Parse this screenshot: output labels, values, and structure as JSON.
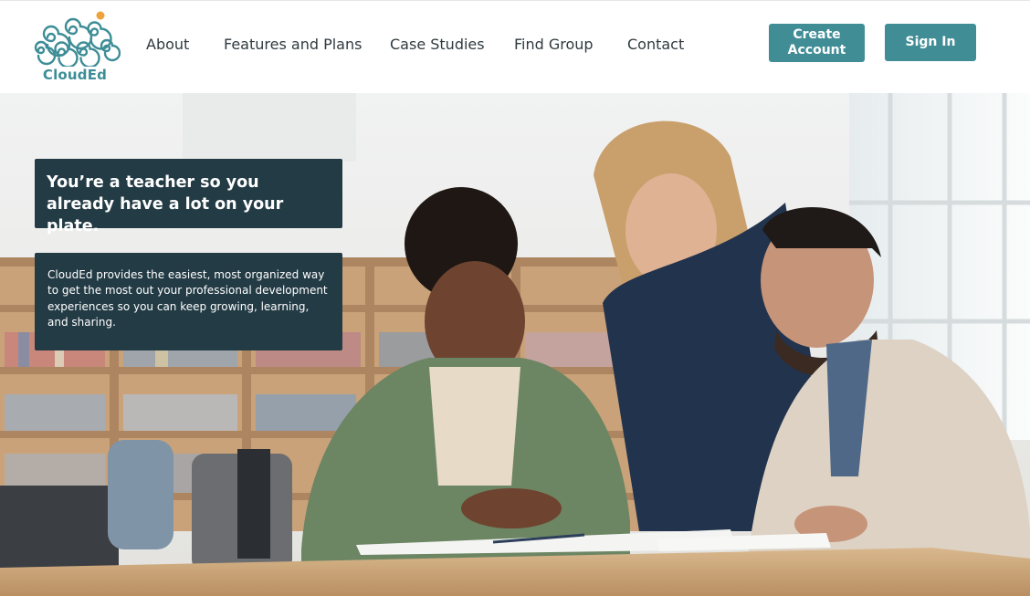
{
  "brand": {
    "name": "CloudEd",
    "logo_icon": "spiral-cloud-logo",
    "accent_color": "#3d8d96",
    "dot_color": "#f0a23a"
  },
  "nav": {
    "items": [
      {
        "label": "About"
      },
      {
        "label": "Features and Plans"
      },
      {
        "label": "Case Studies"
      },
      {
        "label": "Find Group"
      },
      {
        "label": "Contact"
      }
    ]
  },
  "actions": {
    "create_account": "Create Account",
    "sign_in": "Sign In",
    "button_color": "#418d96"
  },
  "hero": {
    "headline": "You’re a teacher so you already have a lot on your plate.",
    "body": "CloudEd provides the easiest, most organized way to get the most out your professional development experiences so you can keep growing, learning, and sharing.",
    "box_color": "#233b45",
    "image_description_icon": "teachers-collaborating-photo"
  }
}
